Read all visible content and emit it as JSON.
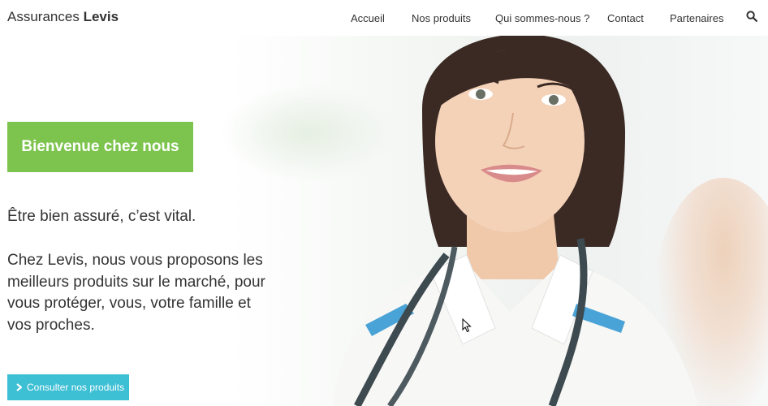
{
  "brand": {
    "prefix": "Assurances",
    "name": "Levis"
  },
  "nav": {
    "items": [
      {
        "label": "Accueil"
      },
      {
        "label": "Nos produits"
      },
      {
        "label": "Qui sommes-nous ?"
      },
      {
        "label": "Contact"
      },
      {
        "label": "Partenaires"
      }
    ],
    "search_icon": "search-icon"
  },
  "hero": {
    "welcome": "Bienvenue chez nous",
    "tagline": "Être bien assuré, c’est vital.",
    "description": "Chez Levis, nous vous proposons les meilleurs produits sur le marché, pour vous protéger, vous, votre famille et vos proches.",
    "cta_label": "Consulter nos produits",
    "cta_icon": "chevron-right-icon"
  },
  "colors": {
    "welcome_bg": "#7dc44e",
    "cta_bg": "#3dbfd4",
    "text": "#333333"
  }
}
